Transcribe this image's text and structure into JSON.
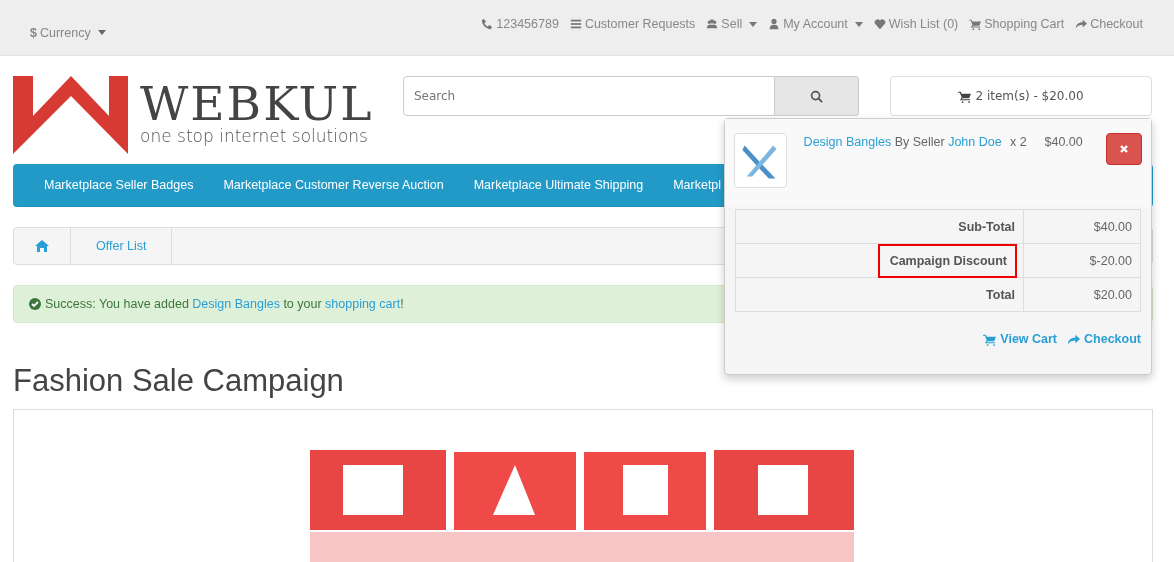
{
  "top_bar": {
    "currency": {
      "symbol": "$",
      "label": "Currency"
    },
    "links": [
      {
        "label": "123456789",
        "caret": false
      },
      {
        "label": "Customer Requests",
        "caret": false
      },
      {
        "label": "Sell",
        "caret": true
      },
      {
        "label": "My Account",
        "caret": true
      },
      {
        "label": "Wish List (0)",
        "caret": false
      },
      {
        "label": "Shopping Cart",
        "caret": false
      },
      {
        "label": "Checkout",
        "caret": false
      }
    ]
  },
  "logo": {
    "name": "WEBKUL",
    "tagline": "one stop internet solutions"
  },
  "search": {
    "placeholder": "Search"
  },
  "cart_button": {
    "label": "2 item(s) - $20.00"
  },
  "menu": [
    "Marketplace Seller Badges",
    "Marketplace Customer Reverse Auction",
    "Marketplace Ultimate Shipping",
    "Marketpl"
  ],
  "breadcrumb": [
    "Offer List"
  ],
  "alert": {
    "prefix": "Success: You have added ",
    "product": "Design Bangles",
    "middle": " to your ",
    "link": "shopping cart",
    "suffix": "!"
  },
  "heading": "Fashion Sale Campaign",
  "banner": {
    "kind": "picture"
  },
  "cart_dropdown": {
    "item": {
      "name": "Design Bangles",
      "by": "By Seller",
      "seller": "John Doe",
      "qty": "x 2",
      "price": "$40.00"
    },
    "totals": [
      {
        "label": "Sub-Total",
        "value": "$40.00",
        "highlighted": false
      },
      {
        "label": "Campaign Discount",
        "value": "$-20.00",
        "highlighted": true
      },
      {
        "label": "Total",
        "value": "$20.00",
        "highlighted": false
      }
    ],
    "actions": [
      "View Cart",
      "Checkout"
    ]
  }
}
